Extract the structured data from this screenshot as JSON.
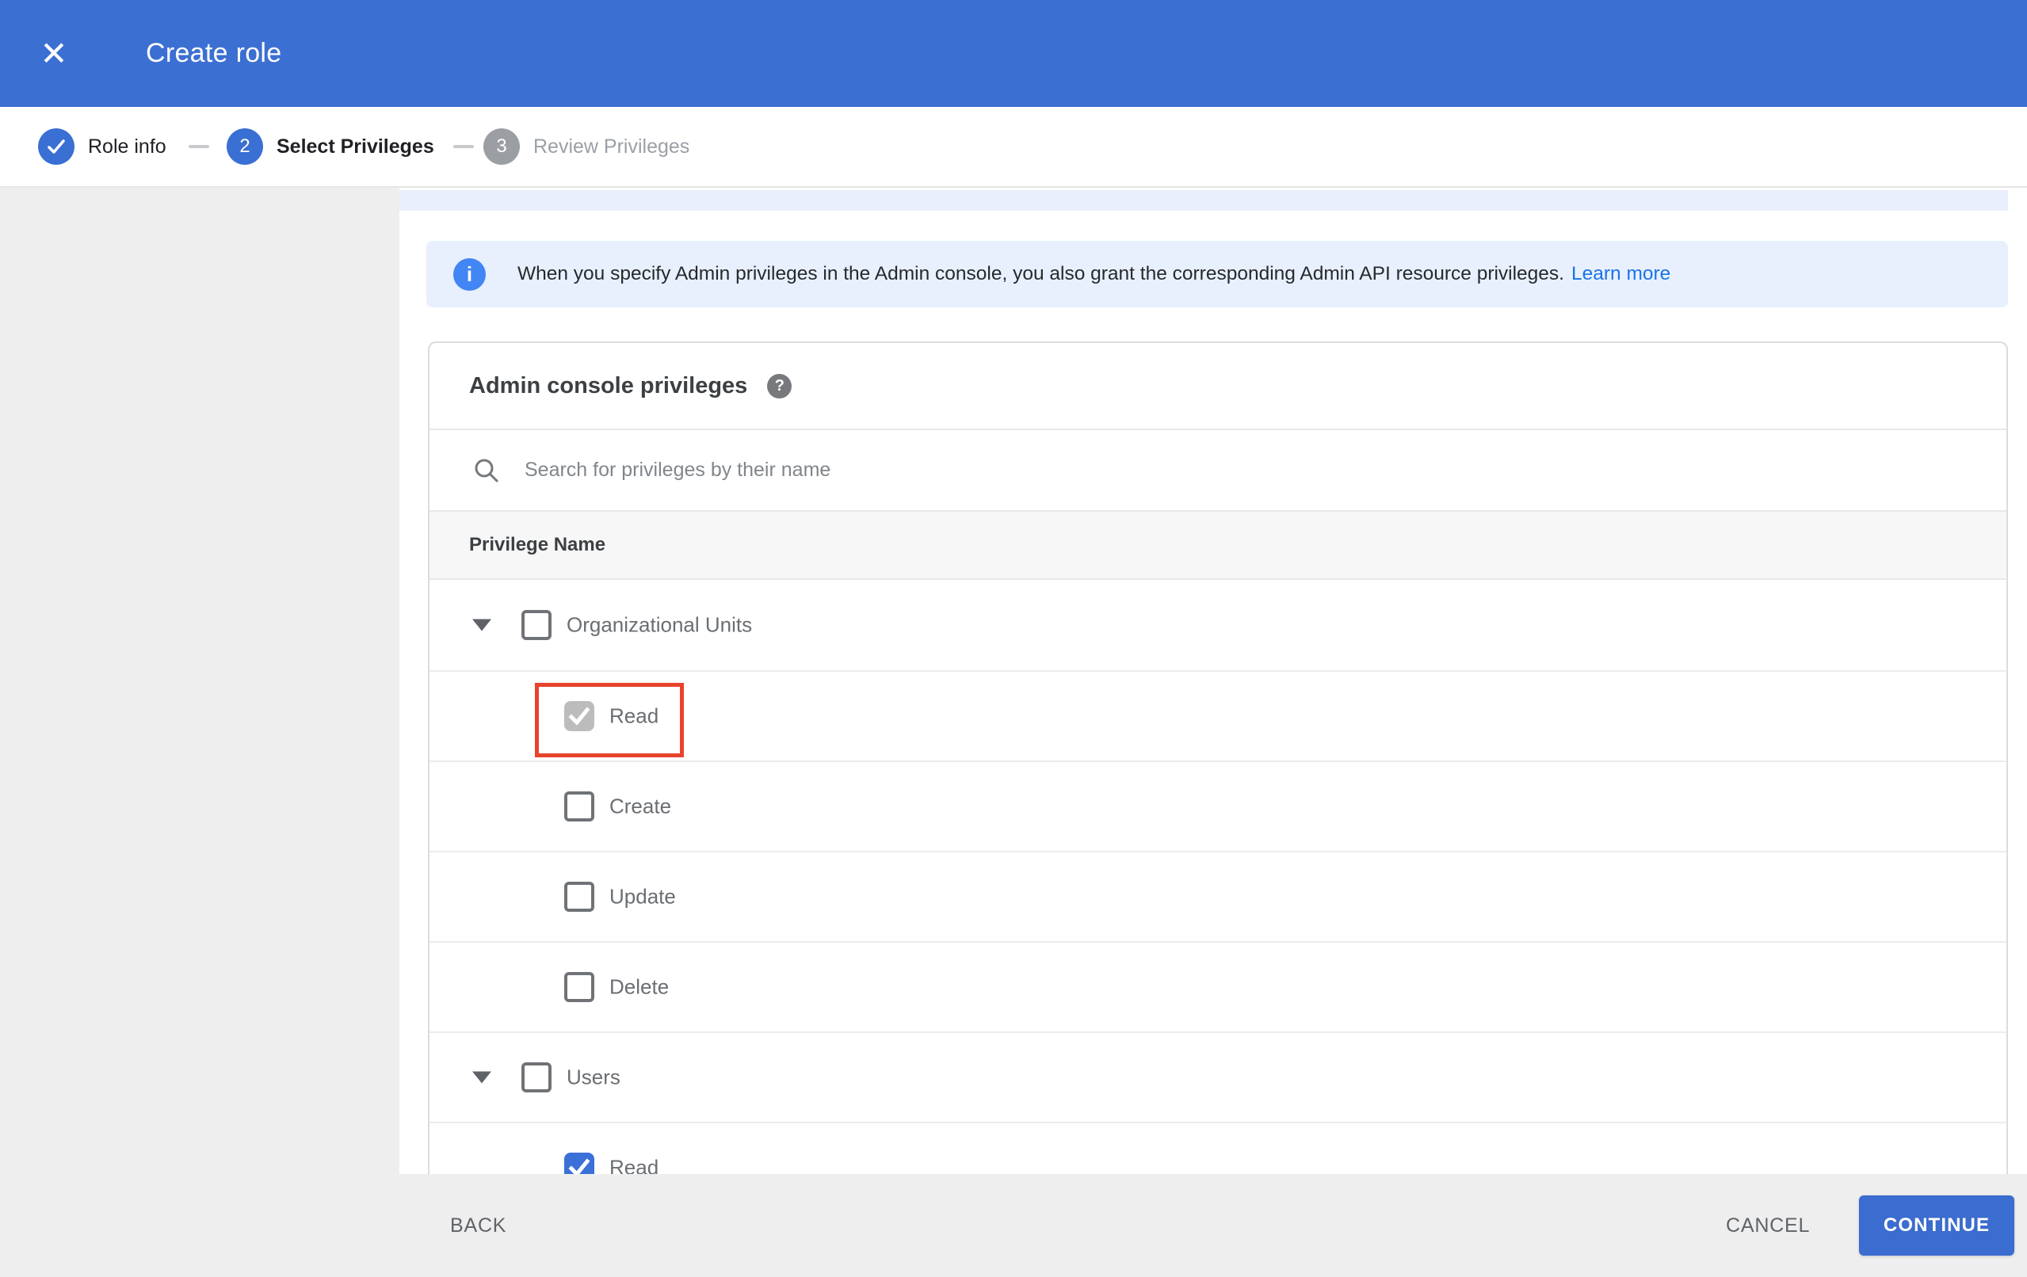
{
  "window": {
    "title": "Create role"
  },
  "icons": {
    "close": "✕",
    "info": "i",
    "help": "?"
  },
  "stepper": {
    "steps": [
      {
        "label": "Role info",
        "state": "completed"
      },
      {
        "label": "Select Privileges",
        "number": "2",
        "state": "active"
      },
      {
        "label": "Review Privileges",
        "number": "3",
        "state": "upcoming"
      }
    ]
  },
  "banner": {
    "text": "When you specify Admin privileges in the Admin console, you also grant the corresponding Admin API resource privileges.",
    "link_label": "Learn more"
  },
  "privileges": {
    "title": "Admin console privileges",
    "search_placeholder": "Search for privileges by their name",
    "column_header": "Privilege Name",
    "rows": [
      {
        "label": "Organizational Units",
        "level": "parent",
        "expanded": true,
        "checked": false
      },
      {
        "label": "Read",
        "level": "child",
        "checked": true,
        "check_style": "gray-disabled",
        "highlighted": true
      },
      {
        "label": "Create",
        "level": "child",
        "checked": false
      },
      {
        "label": "Update",
        "level": "child",
        "checked": false
      },
      {
        "label": "Delete",
        "level": "child",
        "checked": false
      },
      {
        "label": "Users",
        "level": "parent",
        "expanded": true,
        "checked": false
      },
      {
        "label": "Read",
        "level": "child",
        "checked": true,
        "check_style": "blue",
        "clipped_by_footer": true
      }
    ]
  },
  "footer": {
    "back_label": "BACK",
    "cancel_label": "CANCEL",
    "continue_label": "CONTINUE"
  },
  "colors": {
    "appbar_blue": "#3c6fd2",
    "step_blue": "#3a6fd3",
    "step_gray": "#9b9ea2",
    "banner_bg": "#e8f0fe",
    "info_icon_blue": "#4285f4",
    "link_blue": "#1a73e8",
    "checked_blue": "#3b70d9",
    "checked_gray": "#bcbcbc",
    "highlight_red": "#e8432c",
    "footer_bg": "#eeeeee",
    "continue_btn_blue": "#3b6ccf"
  }
}
